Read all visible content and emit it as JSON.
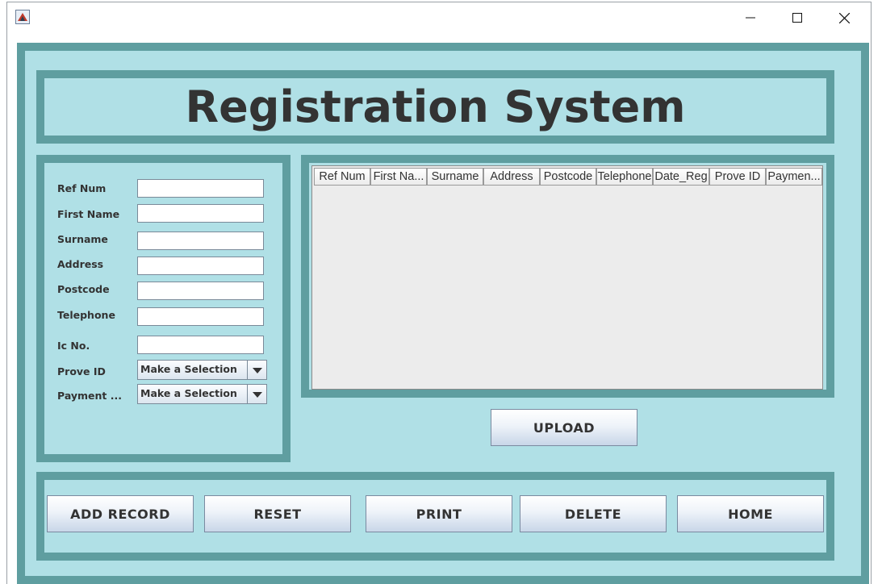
{
  "window": {
    "minimize_glyph": "—",
    "maximize_glyph": "☐",
    "close_glyph": "✕"
  },
  "header": {
    "title": "Registration System"
  },
  "form": {
    "fields": [
      {
        "label": "Ref Num",
        "value": ""
      },
      {
        "label": "First Name",
        "value": ""
      },
      {
        "label": "Surname",
        "value": ""
      },
      {
        "label": "Address",
        "value": ""
      },
      {
        "label": "Postcode",
        "value": ""
      },
      {
        "label": "Telephone",
        "value": ""
      },
      {
        "label": "Ic No.",
        "value": ""
      }
    ],
    "prove_id": {
      "label": "Prove ID",
      "selected": "Make a Selection"
    },
    "payment": {
      "label": "Payment ...",
      "selected": "Make a Selection"
    }
  },
  "table": {
    "columns": [
      "Ref Num",
      "First Na...",
      "Surname",
      "Address",
      "Postcode",
      "Telephone",
      "Date_Reg",
      "Prove ID",
      "Paymen..."
    ],
    "rows": []
  },
  "buttons": {
    "upload": "UPLOAD",
    "add_record": "ADD RECORD",
    "reset": "RESET",
    "print": "PRINT",
    "delete": "DELETE",
    "home": "HOME"
  },
  "colors": {
    "frame": "#5f9ea0",
    "panel": "#b0e0e6",
    "title_text": "#333333"
  }
}
